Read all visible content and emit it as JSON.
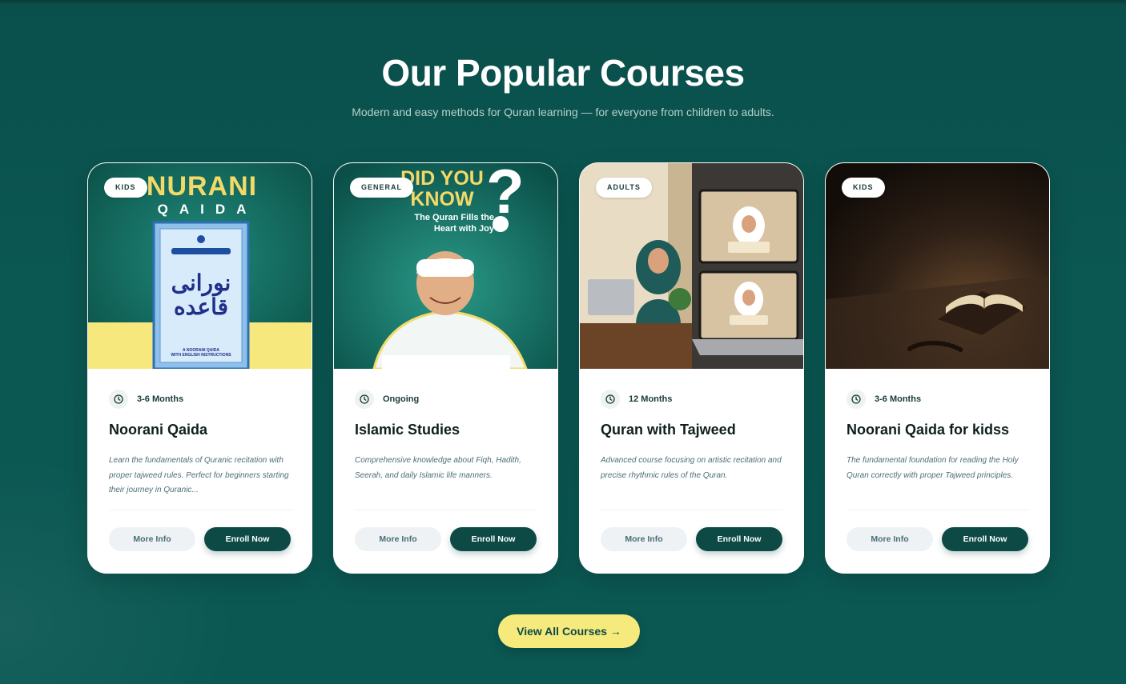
{
  "section": {
    "title": "Our Popular Courses",
    "subtitle": "Modern and easy methods for Quran learning — for everyone from children to adults."
  },
  "courses": [
    {
      "badge": "KIDS",
      "duration": "3-6 Months",
      "title": "Noorani Qaida",
      "description": "Learn the fundamentals of Quranic recitation with proper tajweed rules. Perfect for beginners starting their journey in Quranic...",
      "more_label": "More Info",
      "enroll_label": "Enroll Now",
      "image": {
        "headline": "NURANI",
        "subheadline": "QAIDA",
        "book_arabic_line1": "نورانی",
        "book_arabic_line2": "قاعده",
        "book_caption_line1": "A NOORANI QAIDA",
        "book_caption_line2": "WITH ENGLISH INSTRUCTIONS"
      }
    },
    {
      "badge": "GENERAL",
      "duration": "Ongoing",
      "title": "Islamic Studies",
      "description": "Comprehensive knowledge about Fiqh, Hadith, Seerah, and daily Islamic life manners.",
      "more_label": "More Info",
      "enroll_label": "Enroll Now",
      "image": {
        "headline_line1": "DID YOU",
        "headline_line2": "KNOW",
        "question_mark": "?",
        "tagline_line1": "The Quran Fills the",
        "tagline_line2": "Heart with Joy"
      }
    },
    {
      "badge": "ADULTS",
      "duration": "12 Months",
      "title": "Quran with Tajweed",
      "description": "Advanced course focusing on artistic recitation and precise rhythmic rules of the Quran.",
      "more_label": "More Info",
      "enroll_label": "Enroll Now"
    },
    {
      "badge": "KIDS",
      "duration": "3-6 Months",
      "title": "Noorani Qaida for kidss",
      "description": "The fundamental foundation for reading the Holy Quran correctly with proper Tajweed principles.",
      "more_label": "More Info",
      "enroll_label": "Enroll Now"
    }
  ],
  "view_all_label": "View All Courses →",
  "colors": {
    "background": "#0b5752",
    "primary_button": "#0d4a45",
    "accent_yellow": "#f6ea7c",
    "card_bg": "#ffffff"
  },
  "icons": {
    "duration": "clock-icon",
    "view_all": "arrow-right"
  }
}
